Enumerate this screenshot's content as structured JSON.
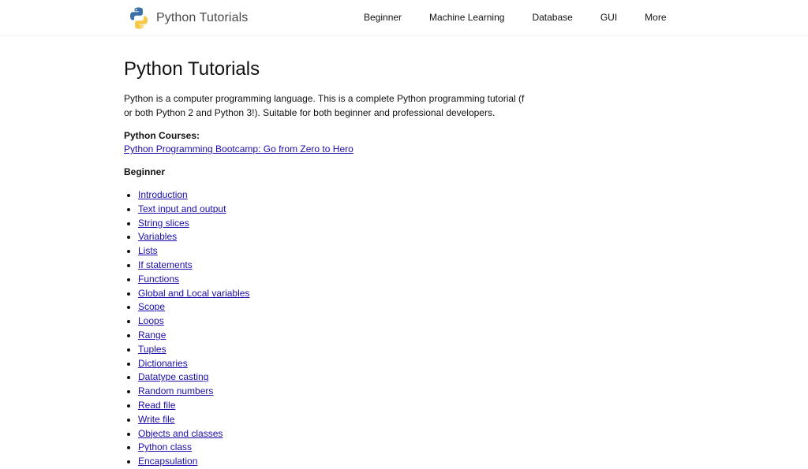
{
  "header": {
    "logo_text": "Python Tutorials",
    "logo_icon": "python-logo-icon",
    "nav": [
      "Beginner",
      "Machine Learning",
      "Database",
      "GUI",
      "More"
    ]
  },
  "main": {
    "title": "Python Tutorials",
    "intro_line1": "Python is a computer programming language. This is a complete Python programming tutorial (f",
    "intro_line2": "or both Python 2 and Python 3!). Suitable for both beginner and professional developers.",
    "courses_heading": "Python Courses:",
    "courses_link": "Python Programming Bootcamp: Go from Zero to Hero",
    "section_heading": "Beginner",
    "topics": [
      "Introduction",
      "Text input and output",
      "String slices",
      "Variables",
      "Lists",
      "If statements",
      "Functions",
      "Global and Local variables",
      "Scope",
      "Loops",
      "Range",
      "Tuples",
      "Dictionaries",
      "Datatype casting",
      "Random numbers",
      "Read file",
      "Write file",
      "Objects and classes",
      "Python class",
      "Encapsulation"
    ]
  },
  "colors": {
    "link": "#1a0dab",
    "text": "#111111",
    "python_blue": "#3b6fa8",
    "python_yellow": "#f7c948"
  }
}
